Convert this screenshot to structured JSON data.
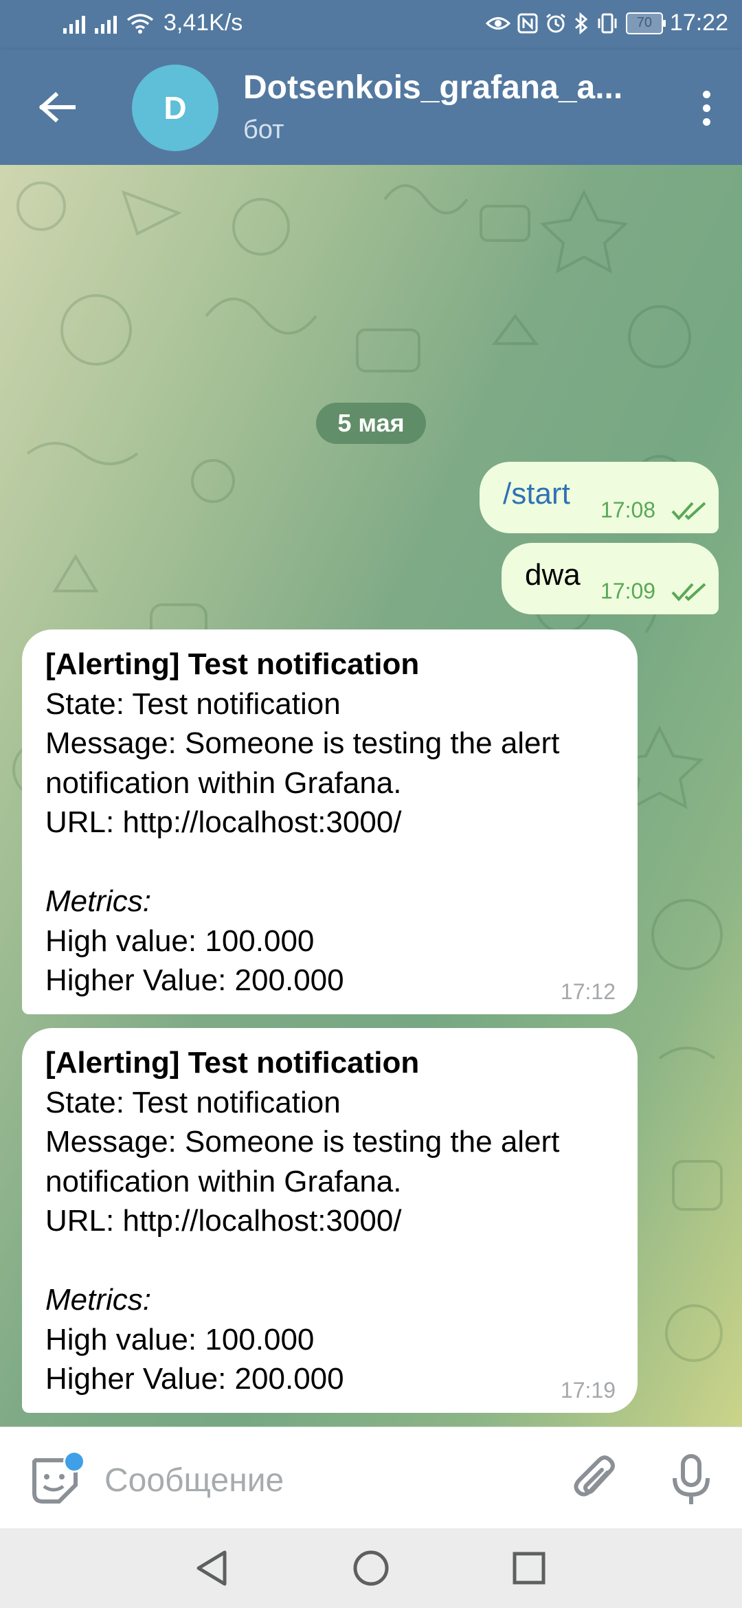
{
  "status_bar": {
    "net_speed": "3,41K/s",
    "battery": "70",
    "time": "17:22"
  },
  "header": {
    "avatar_letter": "D",
    "title": "Dotsenkois_grafana_a...",
    "subtitle": "бот"
  },
  "date_separator": "5 мая",
  "outgoing": [
    {
      "text": "/start",
      "time": "17:08"
    },
    {
      "text": "dwa",
      "time": "17:09"
    }
  ],
  "incoming": [
    {
      "lines": [
        "[Alerting] Test notification",
        "State: Test notification",
        "Message: Someone is testing the alert",
        "notification within Grafana.",
        "URL: http://localhost:3000/",
        "",
        "Metrics:",
        "High value: 100.000",
        "Higher Value: 200.000"
      ],
      "time": "17:12"
    },
    {
      "lines": [
        "[Alerting] Test notification",
        "State: Test notification",
        "Message: Someone is testing the alert",
        "notification within Grafana.",
        "URL: http://localhost:3000/",
        "",
        "Metrics:",
        "High value: 100.000",
        "Higher Value: 200.000"
      ],
      "time": "17:19"
    }
  ],
  "input": {
    "placeholder": "Сообщение",
    "value": ""
  },
  "colors": {
    "header": "#5379a0",
    "outgoing_bubble": "#effdde",
    "incoming_bubble": "#ffffff",
    "read_check": "#5aa856",
    "command_link": "#2f72b5"
  },
  "icons": [
    "signal-icon",
    "wifi-icon",
    "eye-icon",
    "nfc-icon",
    "alarm-icon",
    "bluetooth-icon",
    "vibrate-icon",
    "battery-icon",
    "back-arrow-icon",
    "more-vert-icon",
    "double-check-icon",
    "sticker-icon",
    "attach-icon",
    "mic-icon",
    "nav-back-icon",
    "nav-home-icon",
    "nav-recents-icon"
  ]
}
